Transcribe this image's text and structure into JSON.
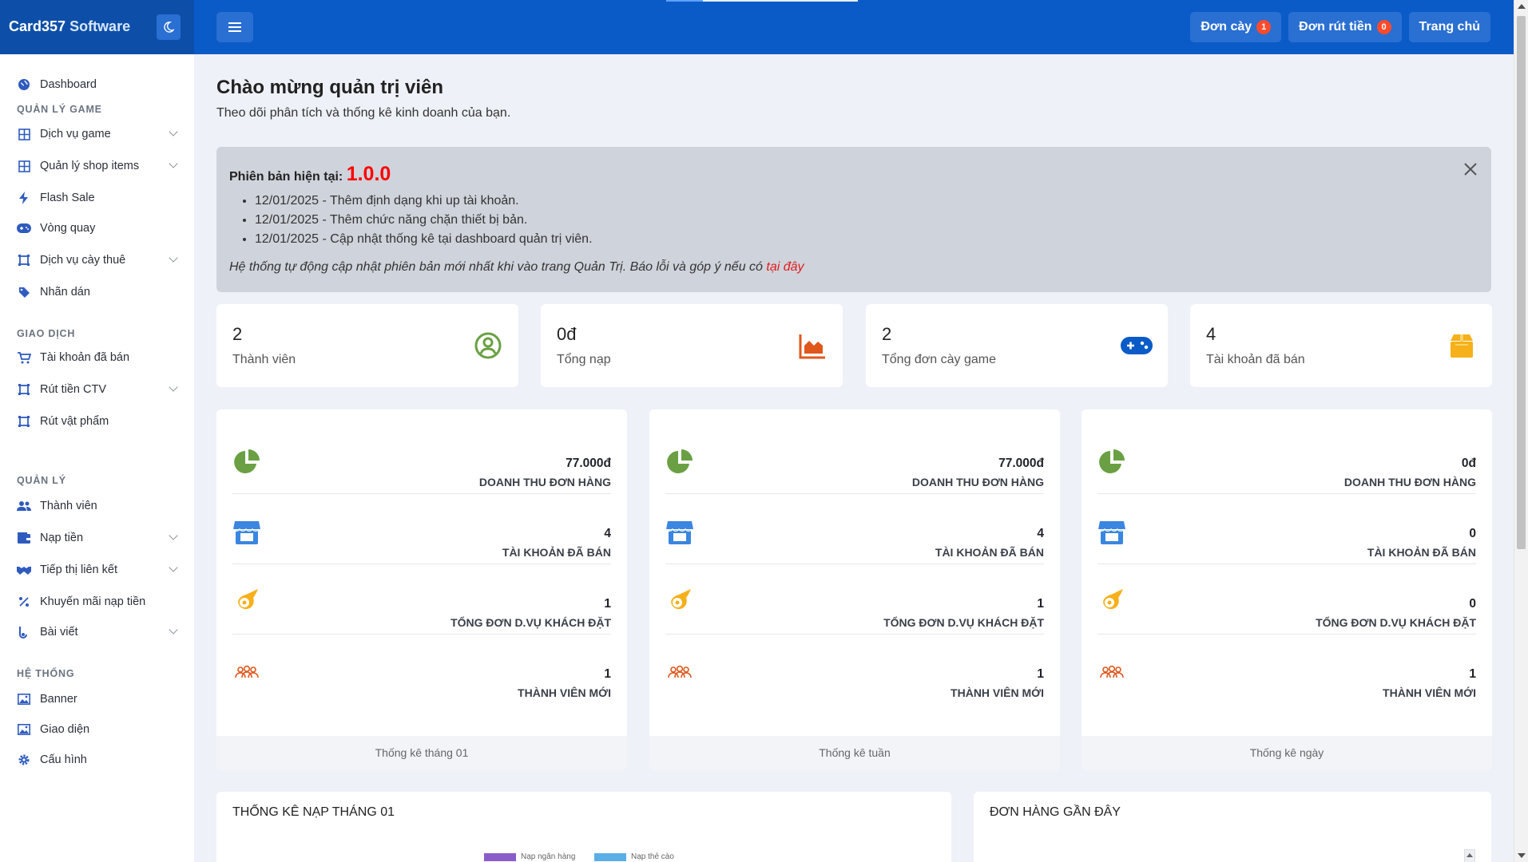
{
  "brand": {
    "name": "Card357",
    "suffix": "Software"
  },
  "topbar": {
    "buttons": [
      {
        "label": "Đơn cày",
        "badge": "1"
      },
      {
        "label": "Đơn rút tiền",
        "badge": "0"
      },
      {
        "label": "Trang chủ"
      }
    ]
  },
  "sidebar": {
    "dashboard": "Dashboard",
    "sections": {
      "game": "QUẢN LÝ GAME",
      "trade": "GIAO DỊCH",
      "manage": "QUẢN LÝ",
      "system": "HỆ THỐNG"
    },
    "items": {
      "game_services": "Dịch vụ game",
      "shop_items": "Quản lý shop items",
      "flash_sale": "Flash Sale",
      "wheel": "Vòng quay",
      "boosting": "Dịch vụ cày thuê",
      "stickers": "Nhãn dán",
      "sold_accounts": "Tài khoản đã bán",
      "withdraw_ctv": "Rút tiền CTV",
      "withdraw_items": "Rút vật phẩm",
      "members": "Thành viên",
      "deposit": "Nạp tiền",
      "affiliate": "Tiếp thị liên kết",
      "deposit_promo": "Khuyến mãi nạp tiền",
      "posts": "Bài viết",
      "banner": "Banner",
      "theme": "Giao diện",
      "config": "Cấu hình"
    }
  },
  "greeting": {
    "title": "Chào mừng quản trị viên",
    "subtitle": "Theo dõi phân tích và thống kê kinh doanh của bạn."
  },
  "version_alert": {
    "label": "Phiên bản hiện tại:",
    "version": "1.0.0",
    "changes": [
      "12/01/2025 - Thêm định dạng khi up tài khoản.",
      "12/01/2025 - Thêm chức năng chặn thiết bị bản.",
      "12/01/2025 - Cập nhật thống kê tại dashboard quản trị viên."
    ],
    "note": "Hệ thống tự động cập nhật phiên bản mới nhất khi vào trang Quản Trị. Báo lỗi và góp ý nếu có",
    "link": "tại đây"
  },
  "stats": [
    {
      "value": "2",
      "label": "Thành viên",
      "icon": "user-circle-icon",
      "color": "#6aa043"
    },
    {
      "value": "0đ",
      "label": "Tổng nạp",
      "icon": "area-chart-icon",
      "color": "#e0571c"
    },
    {
      "value": "2",
      "label": "Tổng đơn cày game",
      "icon": "gamepad-icon",
      "color": "#0a5bc7"
    },
    {
      "value": "4",
      "label": "Tài khoản đã bán",
      "icon": "box-icon",
      "color": "#f6b01a"
    }
  ],
  "row_labels": [
    "DOANH THU ĐƠN HÀNG",
    "TÀI KHOẢN ĐÃ BÁN",
    "TỔNG ĐƠN D.VỤ KHÁCH ĐẶT",
    "THÀNH VIÊN MỚI"
  ],
  "panels": [
    {
      "values": [
        "77.000đ",
        "4",
        "1",
        "1"
      ],
      "footer": "Thống kê tháng 01"
    },
    {
      "values": [
        "77.000đ",
        "4",
        "1",
        "1"
      ],
      "footer": "Thống kê tuần"
    },
    {
      "values": [
        "0đ",
        "0",
        "0",
        "1"
      ],
      "footer": "Thống kê ngày"
    }
  ],
  "bottom": {
    "deposit_title": "THỐNG KÊ NẠP THÁNG 01",
    "legend": [
      {
        "label": "Nạp ngân hàng",
        "color": "#8a5cc9"
      },
      {
        "label": "Nạp thẻ cào",
        "color": "#5aaee8"
      }
    ],
    "orders_title": "ĐƠN HÀNG GẦN ĐÂY"
  }
}
